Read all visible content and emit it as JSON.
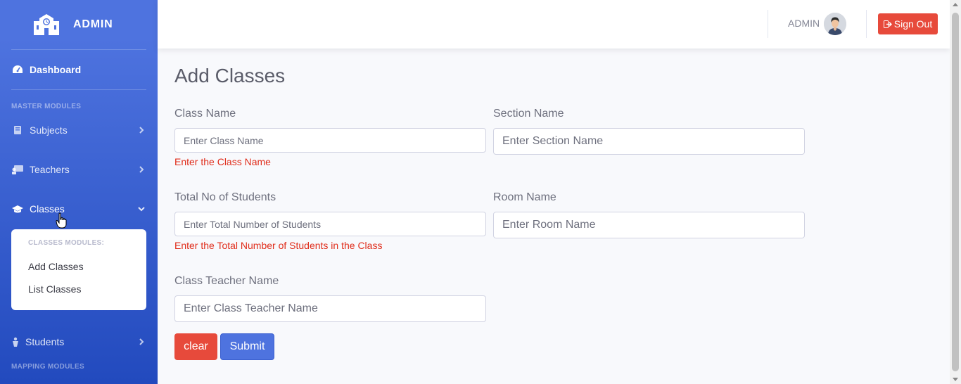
{
  "sidebar": {
    "brand": "ADMIN",
    "dashboard": "Dashboard",
    "master_heading": "MASTER MODULES",
    "items": [
      {
        "label": "Subjects",
        "icon": "book-icon"
      },
      {
        "label": "Teachers",
        "icon": "chalkboard-teacher-icon"
      },
      {
        "label": "Classes",
        "icon": "graduation-cap-icon"
      },
      {
        "label": "Students",
        "icon": "student-icon"
      }
    ],
    "classes_submenu": {
      "heading": "CLASSES MODULES:",
      "items": [
        "Add Classes",
        "List Classes"
      ]
    },
    "mapping_heading": "MAPPING MODULES"
  },
  "topbar": {
    "user_name": "ADMIN",
    "signout": "Sign Out"
  },
  "form": {
    "title": "Add Classes",
    "class_name": {
      "label": "Class Name",
      "placeholder": "Enter Class Name",
      "error": "Enter the Class Name"
    },
    "section_name": {
      "label": "Section Name",
      "placeholder": "Enter Section Name"
    },
    "total_students": {
      "label": "Total No of Students",
      "placeholder": "Enter Total Number of Students",
      "error": "Enter the Total Number of Students in the Class"
    },
    "room_name": {
      "label": "Room Name",
      "placeholder": "Enter Room Name"
    },
    "teacher_name": {
      "label": "Class Teacher Name",
      "placeholder": "Enter Class Teacher Name"
    },
    "clear": "clear",
    "submit": "Submit"
  },
  "colors": {
    "sidebar": "#4e73df",
    "danger": "#e74a3b",
    "primary": "#4e73df",
    "error_text": "#e02d1b"
  }
}
